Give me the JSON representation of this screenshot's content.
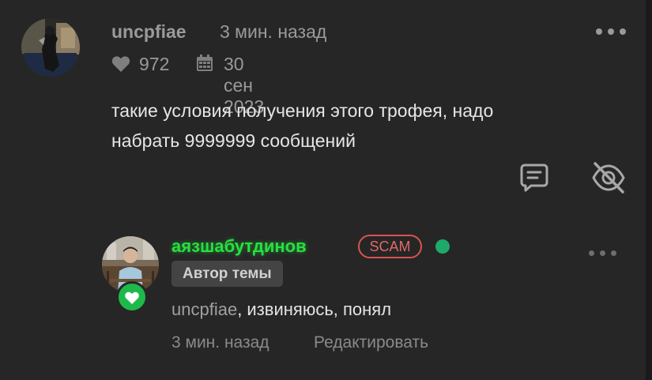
{
  "top_comment": {
    "username": "uncpfiae",
    "time": "3 мин. назад",
    "likes": "972",
    "date": "30 сен 2023",
    "message_line1": "такие условия получения этого трофея, надо",
    "message_line2": "набрать 9999999 сообщений",
    "icons": {
      "more": "more-horizontal-icon",
      "heart": "heart-icon",
      "calendar": "calendar-icon",
      "reply": "reply-icon",
      "hide": "eye-off-icon"
    }
  },
  "reply_comment": {
    "username": "аязшабутдинов",
    "badge": "SCAM",
    "author_label": "Автор темы",
    "mention": "uncpfiae",
    "message": ", извиняюсь, понял",
    "time": "3 мин. назад",
    "edit_label": "Редактировать",
    "icons": {
      "more": "more-horizontal-icon",
      "like_badge": "heart-icon",
      "online": "online-status-dot"
    }
  },
  "colors": {
    "background": "#262626",
    "muted_text": "#9a9a9a",
    "username_green": "#26e040",
    "scam_red": "#d9534f",
    "online_green": "#1ea86a",
    "like_badge_green": "#1fb84b"
  }
}
